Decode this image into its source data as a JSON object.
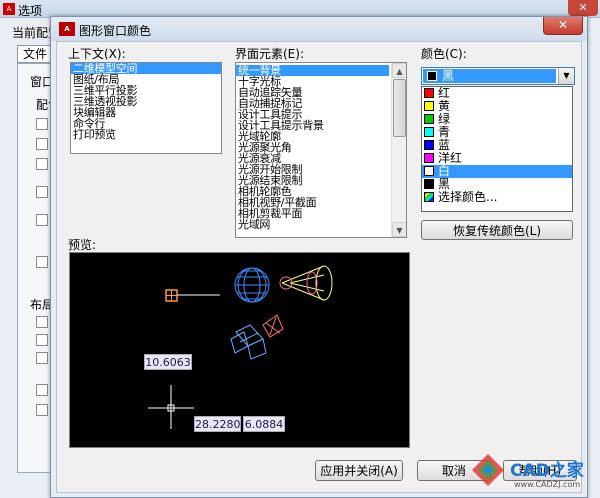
{
  "back_window": {
    "logo": "A",
    "title": "选项",
    "close": "✕",
    "current_config_label": "当前配置",
    "tab_label": "文件",
    "group1_label": "窗口",
    "group1_sub": "配色",
    "group2_label": "布局"
  },
  "dialog": {
    "logo": "A",
    "title": "图形窗口颜色",
    "close": "✕",
    "context_label": "上下文(X):",
    "context_items": [
      "二维模型空间",
      "图纸/布局",
      "三维平行投影",
      "三维透视投影",
      "块编辑器",
      "命令行",
      "打印预览"
    ],
    "element_label": "界面元素(E):",
    "element_items": [
      "统一背景",
      "十字光标",
      "自动追踪矢量",
      "自动捕捉标记",
      "设计工具提示",
      "设计工具提示背景",
      "光域轮廓",
      "光源聚光角",
      "光源衰减",
      "光源开始限制",
      "光源结束限制",
      "相机轮廓色",
      "相机视野/平截面",
      "相机剪裁平面",
      "光域网"
    ],
    "color_label": "颜色(C):",
    "color_selected": "黑",
    "color_options": [
      {
        "name": "红",
        "swatch": "#ff0000"
      },
      {
        "name": "黄",
        "swatch": "#ffff00"
      },
      {
        "name": "绿",
        "swatch": "#00cc00"
      },
      {
        "name": "青",
        "swatch": "#00ffff"
      },
      {
        "name": "蓝",
        "swatch": "#0000ff"
      },
      {
        "name": "洋红",
        "swatch": "#ff00ff"
      },
      {
        "name": "白",
        "swatch": "#ffffff"
      },
      {
        "name": "黑",
        "swatch": "#000000"
      },
      {
        "name": "选择颜色...",
        "swatch": "palette"
      }
    ],
    "highlighted_color": "白",
    "restore_button": "恢复传统颜色(L)",
    "preview_label": "预览:",
    "preview_dims": {
      "radius": "10.6063",
      "x": "28.2280",
      "y": "6.0884"
    },
    "apply_close_button": "应用并关闭(A)",
    "cancel_button": "取消",
    "help_button": "帮助(H)"
  },
  "watermark": {
    "text": "CAD之家",
    "url": "www.CADZJ.com"
  }
}
